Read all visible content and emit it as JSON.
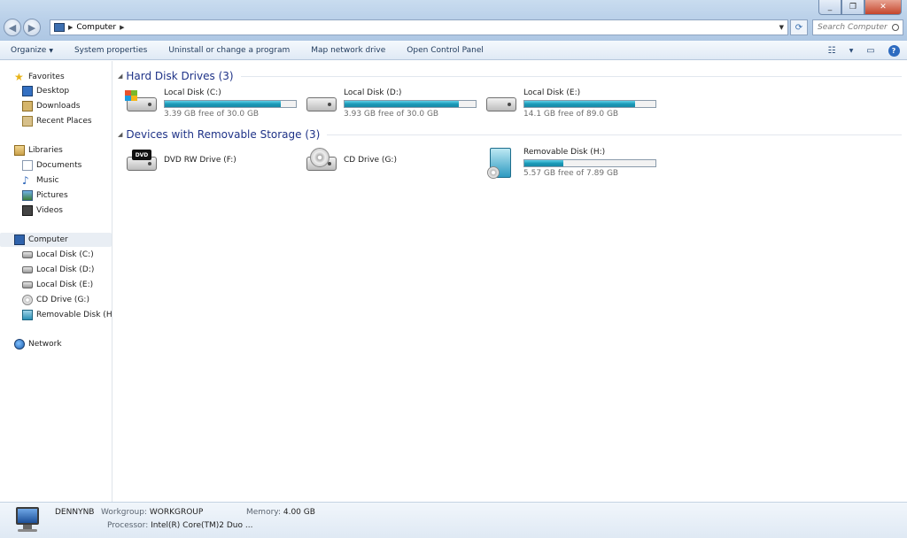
{
  "window": {
    "minimize": "0",
    "maximize": "1",
    "close": "r"
  },
  "address": {
    "crumb": "Computer",
    "search_placeholder": "Search Computer"
  },
  "toolbar": {
    "organize": "Organize",
    "system_properties": "System properties",
    "uninstall": "Uninstall or change a program",
    "map_drive": "Map network drive",
    "control_panel": "Open Control Panel"
  },
  "sidebar": {
    "favorites": "Favorites",
    "desktop": "Desktop",
    "downloads": "Downloads",
    "recent": "Recent Places",
    "libraries": "Libraries",
    "documents": "Documents",
    "music": "Music",
    "pictures": "Pictures",
    "videos": "Videos",
    "computer": "Computer",
    "disk_c": "Local Disk (C:)",
    "disk_d": "Local Disk (D:)",
    "disk_e": "Local Disk (E:)",
    "cd_g": "CD Drive (G:)",
    "rem_h": "Removable Disk (H:)",
    "network": "Network"
  },
  "groups": {
    "hard_disks": "Hard Disk Drives (3)",
    "removable": "Devices with Removable Storage (3)"
  },
  "drives": {
    "c": {
      "name": "Local Disk (C:)",
      "free": "3.39 GB free of 30.0 GB",
      "used_fraction": 0.887
    },
    "d": {
      "name": "Local Disk (D:)",
      "free": "3.93 GB free of 30.0 GB",
      "used_fraction": 0.869
    },
    "e": {
      "name": "Local Disk (E:)",
      "free": "14.1 GB free of 89.0 GB",
      "used_fraction": 0.842
    },
    "f": {
      "name": "DVD RW Drive (F:)"
    },
    "g": {
      "name": "CD Drive (G:)"
    },
    "h": {
      "name": "Removable Disk (H:)",
      "free": "5.57 GB free of 7.89 GB",
      "used_fraction": 0.294
    }
  },
  "details": {
    "computer_name": "DENNYNB",
    "workgroup_label": "Workgroup:",
    "workgroup": "WORKGROUP",
    "memory_label": "Memory:",
    "memory": "4.00 GB",
    "processor_label": "Processor:",
    "processor": "Intel(R) Core(TM)2 Duo ..."
  },
  "icons": {
    "dvd_label": "DVD"
  },
  "colors": {
    "accent": "#1e3287",
    "bar_fill": "#1b9ab8"
  }
}
